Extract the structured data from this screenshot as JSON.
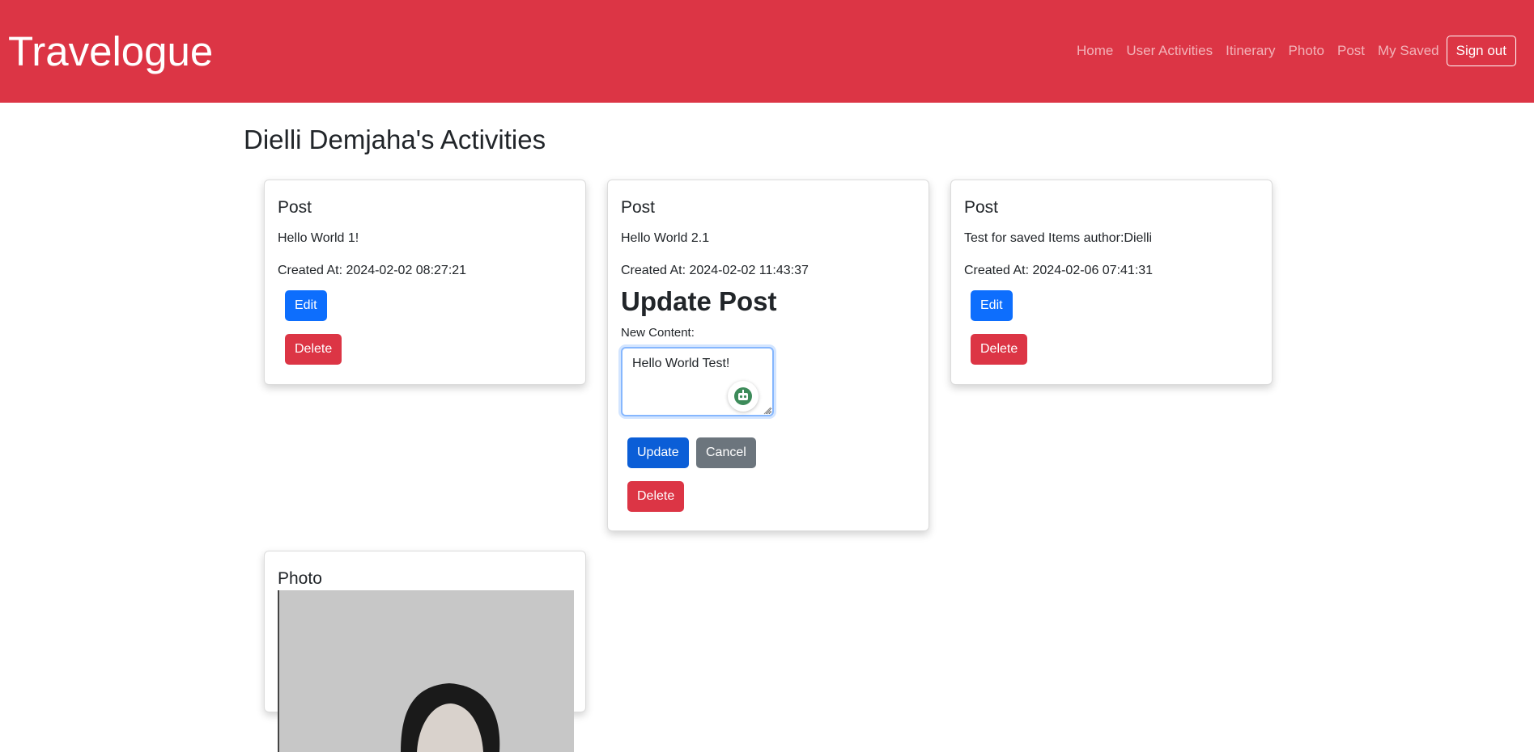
{
  "header": {
    "brand": "Travelogue",
    "nav": [
      "Home",
      "User Activities",
      "Itinerary",
      "Photo",
      "Post",
      "My Saved"
    ],
    "signout_label": "Sign out",
    "background_color": "#dc3545"
  },
  "page": {
    "title": "Dielli Demjaha's Activities"
  },
  "cards": [
    {
      "type": "Post",
      "content": "Hello World 1!",
      "created": "Created At: 2024-02-02 08:27:21",
      "edit_label": "Edit",
      "delete_label": "Delete"
    },
    {
      "type": "Post",
      "content": "Hello World 2.1",
      "created": "Created At: 2024-02-02 11:43:37",
      "update_heading": "Update Post",
      "new_content_label": "New Content:",
      "textarea_value": "Hello World Test!",
      "update_label": "Update",
      "cancel_label": "Cancel",
      "delete_label": "Delete"
    },
    {
      "type": "Post",
      "content": "Test for saved Items author:Dielli",
      "created": "Created At: 2024-02-06 07:41:31",
      "edit_label": "Edit",
      "delete_label": "Delete"
    },
    {
      "type": "Photo"
    }
  ],
  "colors": {
    "primary": "#0d6efd",
    "danger": "#dc3545",
    "secondary": "#6c757d",
    "assistant_icon": "#3d8b5a"
  },
  "icons": {
    "assistant": "robot-icon",
    "resize": "resize-handle-icon"
  }
}
